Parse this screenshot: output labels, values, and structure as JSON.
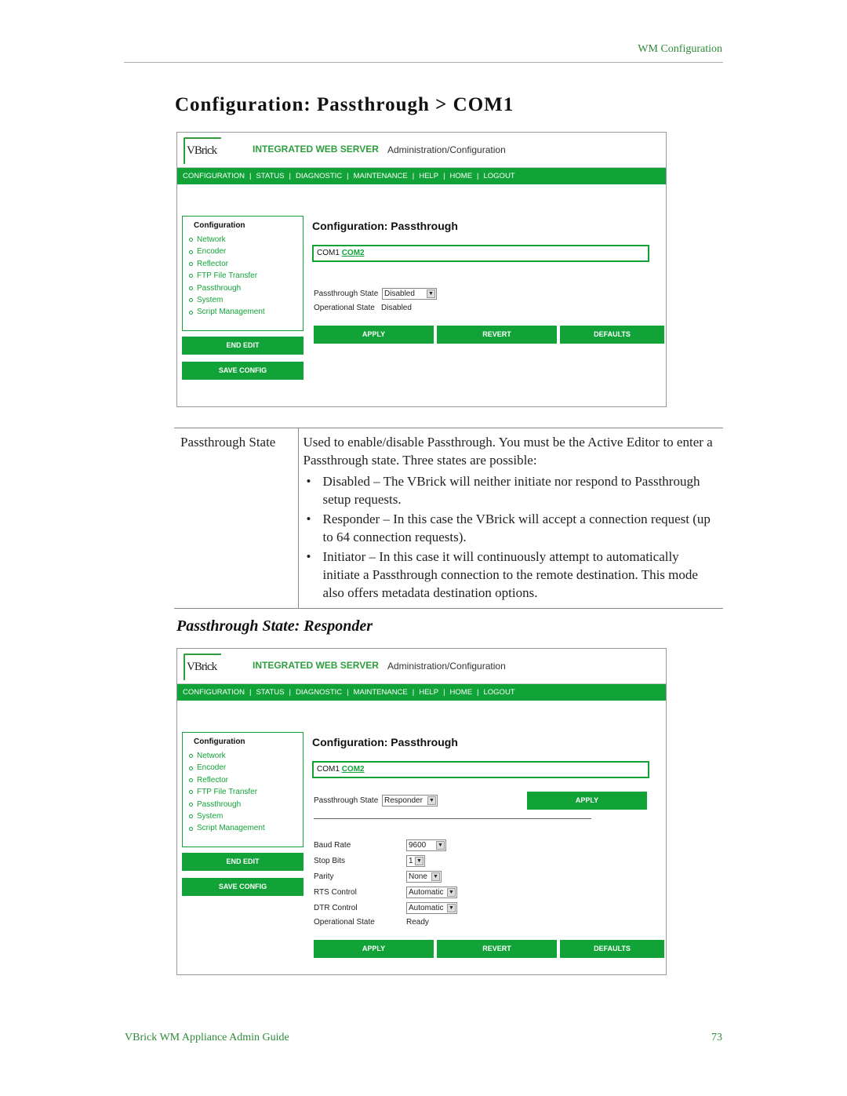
{
  "running_head": "WM Configuration",
  "page_title": "Configuration: Passthrough > COM1",
  "app": {
    "logo": "VBrick",
    "server_label": "INTEGRATED WEB SERVER",
    "admin_label": "Administration/Configuration",
    "nav": [
      "CONFIGURATION",
      "STATUS",
      "DIAGNOSTIC",
      "MAINTENANCE",
      "HELP",
      "HOME",
      "LOGOUT"
    ],
    "sidebar_header": "Configuration",
    "sidebar_items": [
      "Network",
      "Encoder",
      "Reflector",
      "FTP File Transfer",
      "Passthrough",
      "System",
      "Script Management"
    ],
    "end_edit": "END EDIT",
    "save_config": "SAVE CONFIG",
    "cfg_title": "Configuration: Passthrough",
    "com1": "COM1",
    "com2": "COM2",
    "apply": "APPLY",
    "revert": "REVERT",
    "defaults": "DEFAULTS"
  },
  "shot1": {
    "passthrough_state_label": "Passthrough State",
    "passthrough_state_value": "Disabled",
    "operational_state_label": "Operational State",
    "operational_state_value": "Disabled"
  },
  "table": {
    "key": "Passthrough State",
    "intro": "Used to enable/disable Passthrough. You must be the Active Editor to enter a Passthrough state. Three states are possible:",
    "bullets": [
      "Disabled – The VBrick will neither initiate nor respond to Passthrough setup requests.",
      "Responder – In this case the VBrick will accept a connection request (up to 64 connection requests).",
      "Initiator – In this case it will continuously attempt to automatically initiate a Passthrough connection to the remote destination. This mode also offers metadata destination options."
    ]
  },
  "subsection_title": "Passthrough State: Responder",
  "shot2": {
    "passthrough_state_label": "Passthrough State",
    "passthrough_state_value": "Responder",
    "fields": [
      {
        "label": "Baud Rate",
        "value": "9600"
      },
      {
        "label": "Stop Bits",
        "value": "1"
      },
      {
        "label": "Parity",
        "value": "None"
      },
      {
        "label": "RTS Control",
        "value": "Automatic"
      },
      {
        "label": "DTR Control",
        "value": "Automatic"
      }
    ],
    "operational_state_label": "Operational State",
    "operational_state_value": "Ready"
  },
  "footer": {
    "left": "VBrick WM Appliance Admin Guide",
    "page_number": "73"
  }
}
